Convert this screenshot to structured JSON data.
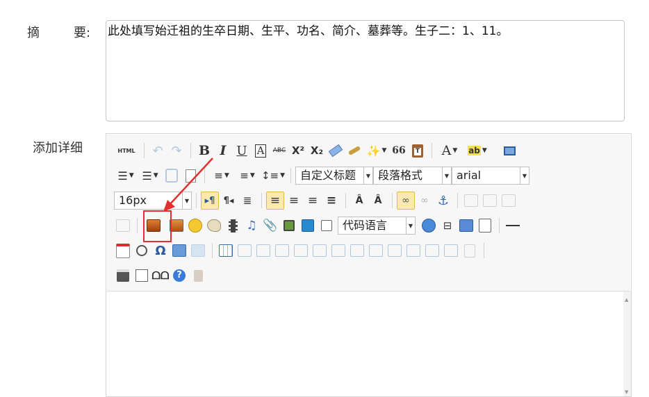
{
  "labels": {
    "summary_a": "摘",
    "summary_b": "要:",
    "detail": "添加详细"
  },
  "summary": {
    "value": "此处填写始迁祖的生卒日期、生平、功名、简介、墓葬等。生子二：1、11。"
  },
  "toolbar": {
    "html_label": "HTML",
    "bold": "B",
    "italic": "I",
    "underline": "U",
    "border_a": "A",
    "strike": "ABC",
    "sup": "X²",
    "sub": "X₂",
    "quote": "66",
    "font_color": "A",
    "custom_title_select": "自定义标题",
    "paragraph_select": "段落格式",
    "font_family_select": "arial",
    "font_size_select": "16px",
    "code_language_select": "代码语言",
    "omega": "Ω"
  },
  "colors": {
    "highlight": "#e03030",
    "active_button": "#fbe9b0"
  }
}
